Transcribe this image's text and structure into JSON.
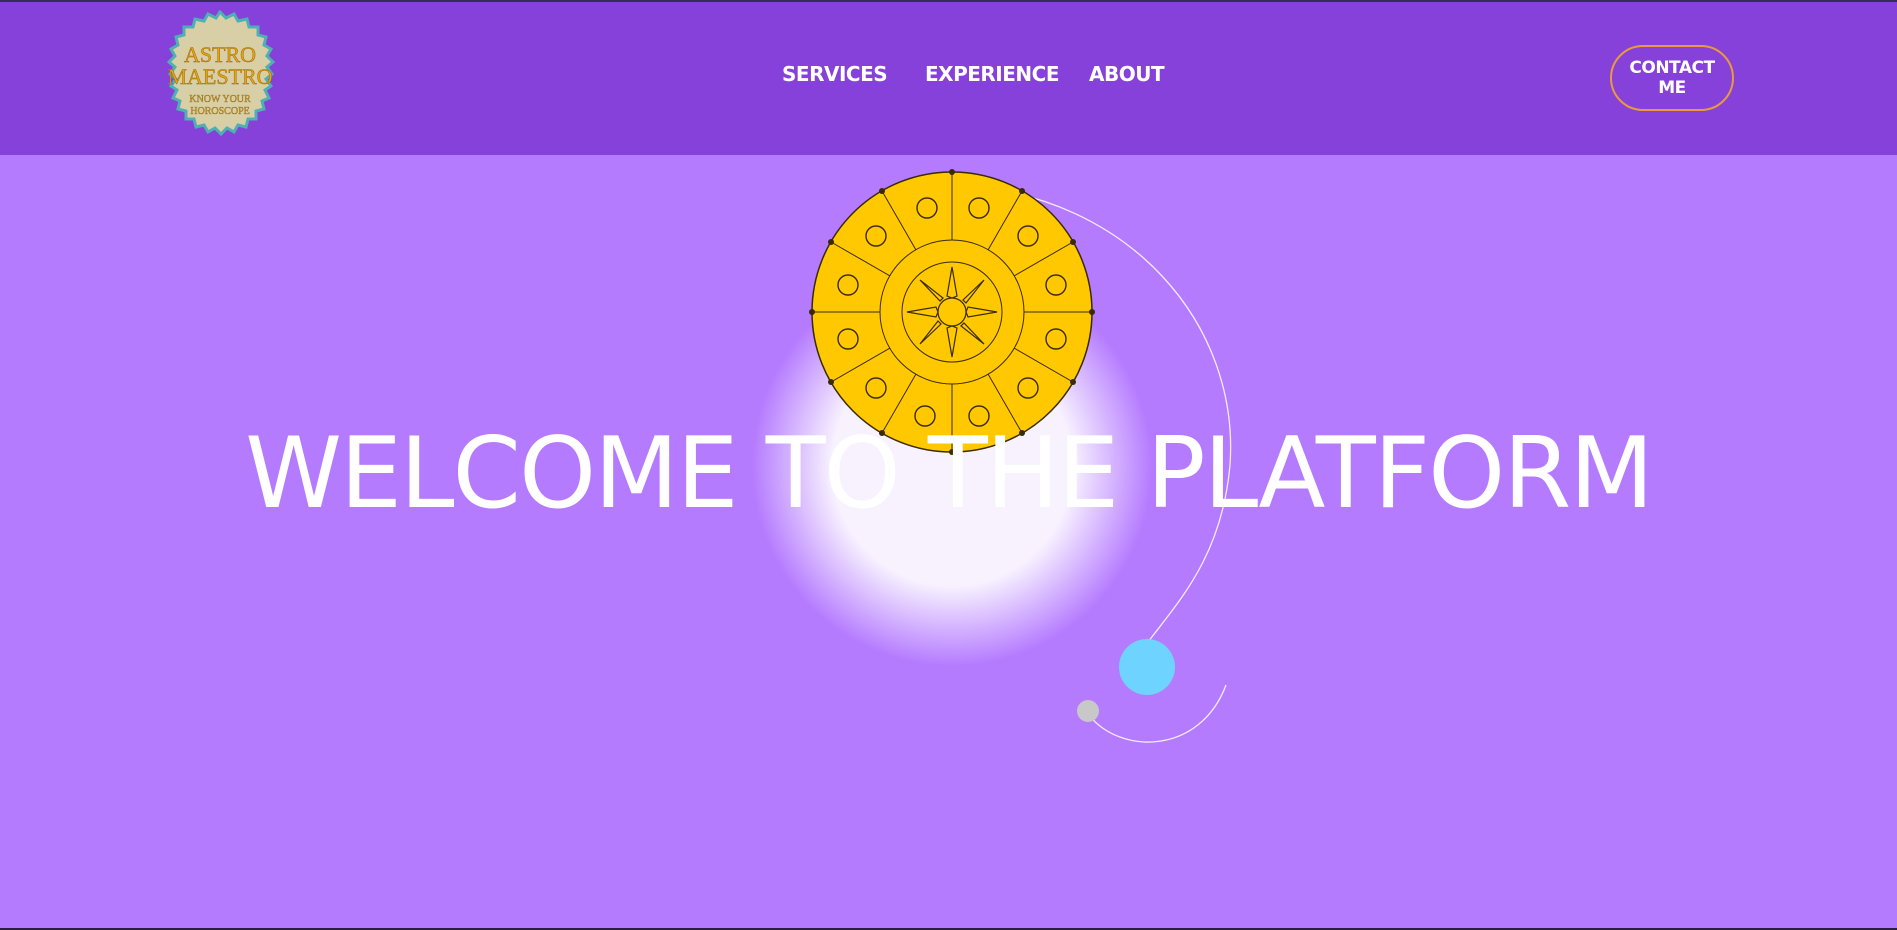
{
  "logo": {
    "line1": "ASTRO",
    "line2": "MAESTRO",
    "line3": "KNOW YOUR",
    "line4": "HOROSCOPE",
    "icon": "logo-badge"
  },
  "nav": {
    "items": [
      {
        "label": "SERVICES"
      },
      {
        "label": "EXPERIENCE"
      },
      {
        "label": "ABOUT"
      }
    ],
    "contact_label": "CONTACT ME"
  },
  "hero": {
    "headline": "WELCOME TO THE PLATFORM",
    "wheel_icon": "zodiac-wheel"
  },
  "colors": {
    "header_bg": "#8541d9",
    "hero_bg": "#b57bff",
    "wheel": "#ffc800",
    "contact_border": "#e89a3c",
    "orb_blue": "#6fd3ff",
    "orb_grey": "#c8c8c8"
  }
}
